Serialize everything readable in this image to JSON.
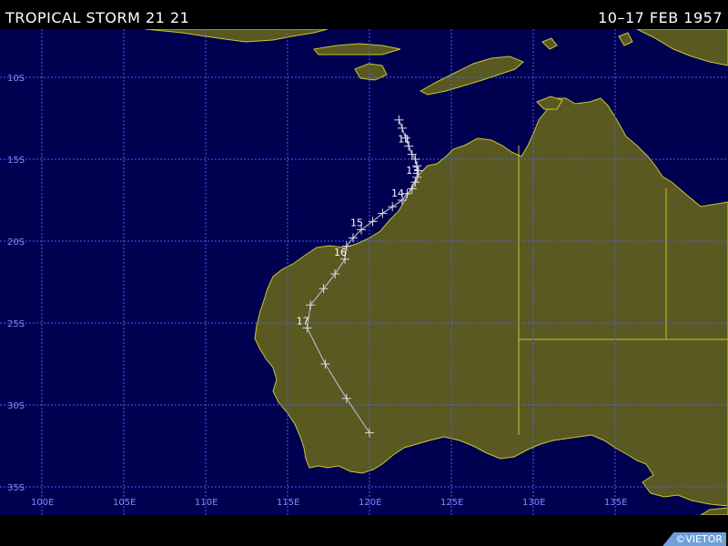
{
  "header": {
    "title": "TROPICAL STORM 21 21",
    "date_range": "10–17 FEB 1957"
  },
  "map": {
    "lat_labels": [
      {
        "lat": -10,
        "label": "10S"
      },
      {
        "lat": -15,
        "label": "15S"
      },
      {
        "lat": -20,
        "label": "20S"
      },
      {
        "lat": -25,
        "label": "25S"
      },
      {
        "lat": -30,
        "label": "30S"
      },
      {
        "lat": -35,
        "label": "35S"
      }
    ],
    "lon_labels": [
      {
        "lon": 100,
        "label": "100E"
      },
      {
        "lon": 105,
        "label": "105E"
      },
      {
        "lon": 110,
        "label": "110E"
      },
      {
        "lon": 115,
        "label": "115E"
      },
      {
        "lon": 120,
        "label": "120E"
      },
      {
        "lon": 125,
        "label": "125E"
      },
      {
        "lon": 130,
        "label": "130E"
      },
      {
        "lon": 135,
        "label": "135E"
      }
    ],
    "colors": {
      "ocean": "#000050",
      "land": "#595921",
      "coast": "#c8c832",
      "grid": "#4b5eff",
      "track": "#b4b4c8",
      "marker": "#dcdce6"
    },
    "track": [
      {
        "lon": 121.8,
        "lat": -12.6
      },
      {
        "lon": 122.0,
        "lat": -13.1
      },
      {
        "lon": 122.2,
        "lat": -13.7
      },
      {
        "lon": 122.4,
        "lat": -14.2,
        "day": "11"
      },
      {
        "lon": 122.6,
        "lat": -14.7
      },
      {
        "lon": 122.8,
        "lat": -15.0
      },
      {
        "lon": 122.9,
        "lat": -15.4
      },
      {
        "lon": 123.0,
        "lat": -15.7
      },
      {
        "lon": 122.9,
        "lat": -16.1,
        "day": "13"
      },
      {
        "lon": 122.8,
        "lat": -16.4
      },
      {
        "lon": 122.6,
        "lat": -16.8
      },
      {
        "lon": 122.3,
        "lat": -17.1
      },
      {
        "lon": 122.0,
        "lat": -17.5,
        "day": "14"
      },
      {
        "lon": 121.4,
        "lat": -17.9
      },
      {
        "lon": 120.8,
        "lat": -18.3
      },
      {
        "lon": 120.2,
        "lat": -18.8
      },
      {
        "lon": 119.5,
        "lat": -19.3,
        "day": "15"
      },
      {
        "lon": 119.0,
        "lat": -19.8
      },
      {
        "lon": 118.6,
        "lat": -20.3
      },
      {
        "lon": 118.5,
        "lat": -21.1,
        "day": "16"
      },
      {
        "lon": 117.9,
        "lat": -22.0
      },
      {
        "lon": 117.2,
        "lat": -22.9
      },
      {
        "lon": 116.4,
        "lat": -23.9
      },
      {
        "lon": 116.2,
        "lat": -25.3,
        "day": "17"
      },
      {
        "lon": 117.3,
        "lat": -27.5
      },
      {
        "lon": 118.6,
        "lat": -29.6
      },
      {
        "lon": 120.0,
        "lat": -31.7
      }
    ]
  },
  "footer": {
    "copyright": "©VIETOR"
  }
}
